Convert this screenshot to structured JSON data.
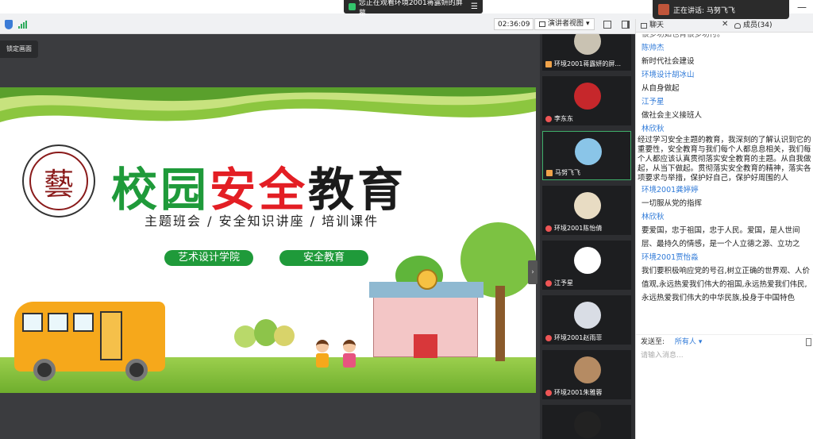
{
  "toast": {
    "text": "您正在观看环境2001蒋露妍的屏幕",
    "menu_icon": "menu-icon"
  },
  "topbar": {
    "timer": "02:36:09",
    "view_label": "演讲者视图"
  },
  "speaker": {
    "label": "正在讲话: 马努飞飞"
  },
  "lock_button": "锁定画面",
  "slide": {
    "title_parts": [
      "校园",
      "安全",
      "教育"
    ],
    "subtitle": "主题班会 / 安全知识讲座 / 培训课件",
    "tags": [
      "艺术设计学院",
      "安全教育"
    ],
    "logo_char": "藝"
  },
  "participants": [
    {
      "name": "环境2001蒋露妍的屏...",
      "avatar_color": "#c9c2b2"
    },
    {
      "name": "李东东",
      "avatar_color": "#c6272b"
    },
    {
      "name": "马努飞飞",
      "avatar_color": "#8ac5e8",
      "active": true
    },
    {
      "name": "环境2001陈怡倩",
      "avatar_color": "#e8dcc3"
    },
    {
      "name": "江予星",
      "avatar_color": "#ffffff"
    },
    {
      "name": "环境2001赵雨菲",
      "avatar_color": "#d9dde5"
    },
    {
      "name": "环境2001朱雅蓉",
      "avatar_color": "#b58b63"
    },
    {
      "name": "",
      "avatar_color": "#222222"
    }
  ],
  "chat": {
    "tab_chat": "聊天",
    "tab_members": "成员(34)",
    "send_to_label": "发送至:",
    "send_to_value": "所有人",
    "input_placeholder": "请输入消息...",
    "messages": [
      {
        "sender": "",
        "text": "很多功如也肯很多功付。"
      },
      {
        "sender": "陈帅杰",
        "text": "新时代社会建设"
      },
      {
        "sender": "环境设计胡冰山",
        "text": "从自身做起"
      },
      {
        "sender": "江予星",
        "text": "做社会主义接班人"
      },
      {
        "sender": "林欣秋",
        "text": "经过学习安全主题的教育，我深刻的了解认识到它的重要性，安全教育与我们每个人都息息相关，我们每个人都应该认真贯彻落实安全教育的主题。从自我做起，从当下做起。贯彻落实安全教育的精神，落实各项要求与举措，保护好自己，保护好周围的人"
      },
      {
        "sender": "环境2001龚婷婷",
        "text": "一切服从党的指挥"
      },
      {
        "sender": "林欣秋",
        "text": "要爱国，忠于祖国，忠于人民。爱国，是人世间层、最持久的情感，是一个人立德之源、立功之"
      },
      {
        "sender": "环境2001贾怡淼",
        "text": "我们要积极响应党的号召,树立正确的世界观、人价值观,永远热爱我们伟大的祖国,永远热爱我们伟民,永远热爱我们伟大的中华民族,投身于中国特色"
      }
    ]
  }
}
